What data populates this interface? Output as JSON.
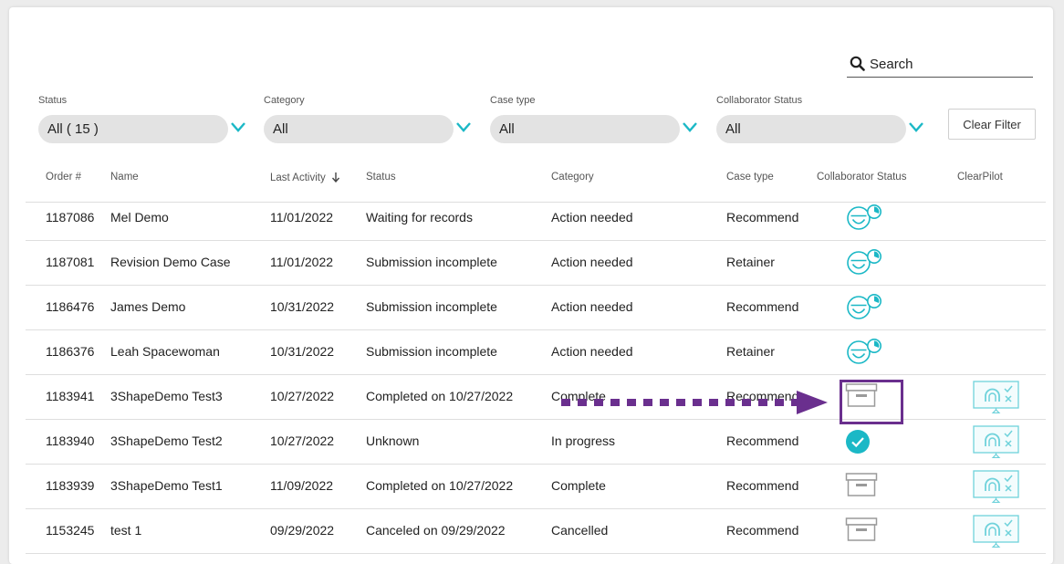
{
  "search": {
    "placeholder": "Search"
  },
  "filters": [
    {
      "label": "Status",
      "value": "All ( 15 )"
    },
    {
      "label": "Category",
      "value": "All"
    },
    {
      "label": "Case type",
      "value": "All"
    },
    {
      "label": "Collaborator Status",
      "value": "All"
    }
  ],
  "clear_filter_label": "Clear Filter",
  "columns": {
    "order": "Order #",
    "name": "Name",
    "last_activity": "Last Activity",
    "status": "Status",
    "category": "Category",
    "case_type": "Case type",
    "collab": "Collaborator Status",
    "clearpilot": "ClearPilot"
  },
  "sort": {
    "column": "Last Activity",
    "direction": "descending"
  },
  "rows": [
    {
      "order": "1187086",
      "name": "Mel Demo",
      "last_activity": "11/01/2022",
      "status": "Waiting for records",
      "category": "Action needed",
      "case_type": "Recommend",
      "collab_icon": "smile-timer-icon",
      "clearpilot_icon": ""
    },
    {
      "order": "1187081",
      "name": "Revision Demo Case",
      "last_activity": "11/01/2022",
      "status": "Submission incomplete",
      "category": "Action needed",
      "case_type": "Retainer",
      "collab_icon": "smile-timer-icon",
      "clearpilot_icon": ""
    },
    {
      "order": "1186476",
      "name": "James Demo",
      "last_activity": "10/31/2022",
      "status": "Submission incomplete",
      "category": "Action needed",
      "case_type": "Recommend",
      "collab_icon": "smile-timer-icon",
      "clearpilot_icon": ""
    },
    {
      "order": "1186376",
      "name": "Leah Spacewoman",
      "last_activity": "10/31/2022",
      "status": "Submission incomplete",
      "category": "Action needed",
      "case_type": "Retainer",
      "collab_icon": "smile-timer-icon",
      "clearpilot_icon": ""
    },
    {
      "order": "1183941",
      "name": "3ShapeDemo Test3",
      "last_activity": "10/27/2022",
      "status": "Completed on 10/27/2022",
      "category": "Complete",
      "case_type": "Recommend",
      "collab_icon": "archive-box-icon",
      "clearpilot_icon": "clearpilot-monitor-icon"
    },
    {
      "order": "1183940",
      "name": "3ShapeDemo Test2",
      "last_activity": "10/27/2022",
      "status": "Unknown",
      "category": "In progress",
      "case_type": "Recommend",
      "collab_icon": "check-circle-icon",
      "clearpilot_icon": "clearpilot-monitor-icon"
    },
    {
      "order": "1183939",
      "name": "3ShapeDemo Test1",
      "last_activity": "11/09/2022",
      "status": "Completed on 10/27/2022",
      "category": "Complete",
      "case_type": "Recommend",
      "collab_icon": "archive-box-icon",
      "clearpilot_icon": "clearpilot-monitor-icon"
    },
    {
      "order": "1153245",
      "name": "test 1",
      "last_activity": "09/29/2022",
      "status": "Canceled on 09/29/2022",
      "category": "Cancelled",
      "case_type": "Recommend",
      "collab_icon": "archive-box-icon",
      "clearpilot_icon": "clearpilot-monitor-icon"
    }
  ],
  "annotation": {
    "highlighted_row_order": "1183941",
    "highlighted_column": "Collaborator Status"
  },
  "colors": {
    "accent": "#1bb8c6",
    "annotation": "#6a2f8e",
    "archive_gray": "#9a9a9a"
  }
}
